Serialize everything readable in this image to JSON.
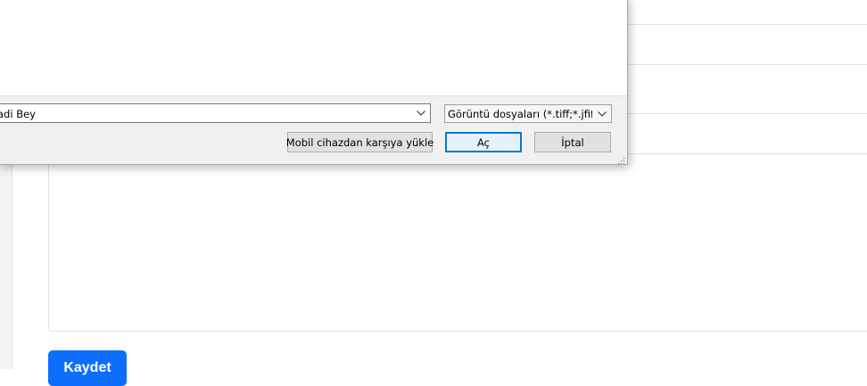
{
  "page": {
    "save_label": "Kaydet"
  },
  "dialog": {
    "file_name_value": "adi Bey",
    "file_type_filter": "Görüntü dosyaları (*.tiff;*.jfif;*.bmp",
    "upload_from_mobile_label": "Mobil cihazdan karşıya yükle",
    "open_label": "Aç",
    "cancel_label": "İptal"
  },
  "colors": {
    "primary": "#0d6efd",
    "dialog_bg": "#f0f0f0",
    "focus_border": "#0078d7"
  },
  "icons": {
    "combo_arrow": "chevron-down-icon",
    "resize": "resize-grip-icon"
  }
}
